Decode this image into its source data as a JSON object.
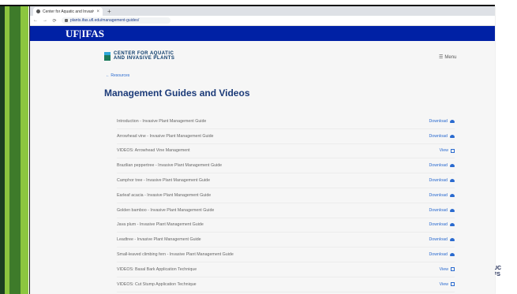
{
  "browser": {
    "tab_title": "Center for Aquatic and Invasiv",
    "tab_close": "×",
    "new_tab": "+",
    "url": "plants.ifas.ufl.edu/management-guides/"
  },
  "header": {
    "logo_left": "UF",
    "logo_right": "IFAS"
  },
  "site": {
    "brand_line1": "CENTER FOR AQUATIC",
    "brand_line2": "AND INVASIVE PLANTS",
    "menu_label": "Menu",
    "back_link": "← Resources",
    "page_title": "Management Guides and Videos"
  },
  "guides": [
    {
      "title": "Introduction - Invasive Plant Management Guide",
      "action": "Download",
      "kind": "download"
    },
    {
      "title": "Arrowhead vine - Invasive Plant Management Guide",
      "action": "Download",
      "kind": "download"
    },
    {
      "title": "VIDEOS: Arrowhead Vine Management",
      "action": "View",
      "kind": "view"
    },
    {
      "title": "Brazilian peppertree - Invasive Plant Management Guide",
      "action": "Download",
      "kind": "download"
    },
    {
      "title": "Camphor tree - Invasive Plant Management Guide",
      "action": "Download",
      "kind": "download"
    },
    {
      "title": "Earleaf acacia - Invasive Plant Management Guide",
      "action": "Download",
      "kind": "download"
    },
    {
      "title": "Golden bamboo - Invasive Plant Management Guide",
      "action": "Download",
      "kind": "download"
    },
    {
      "title": "Java plum - Invasive Plant Management Guide",
      "action": "Download",
      "kind": "download"
    },
    {
      "title": "Leadtree - Invasive Plant Management Guide",
      "action": "Download",
      "kind": "download"
    },
    {
      "title": "Small-leaved climbing fern - Invasive Plant Management Guide",
      "action": "Download",
      "kind": "download"
    },
    {
      "title": "VIDEOS: Basal Bark Application Technique",
      "action": "View",
      "kind": "view"
    },
    {
      "title": "VIDEOS: Cut Stump Application Technique",
      "action": "View",
      "kind": "view"
    }
  ],
  "deco": {
    "right_text": "UC\nFS"
  },
  "colors": {
    "uf_blue": "#0021a5",
    "link": "#2a6acf",
    "title": "#1b3a78",
    "accent_green": "#8cc63f"
  }
}
